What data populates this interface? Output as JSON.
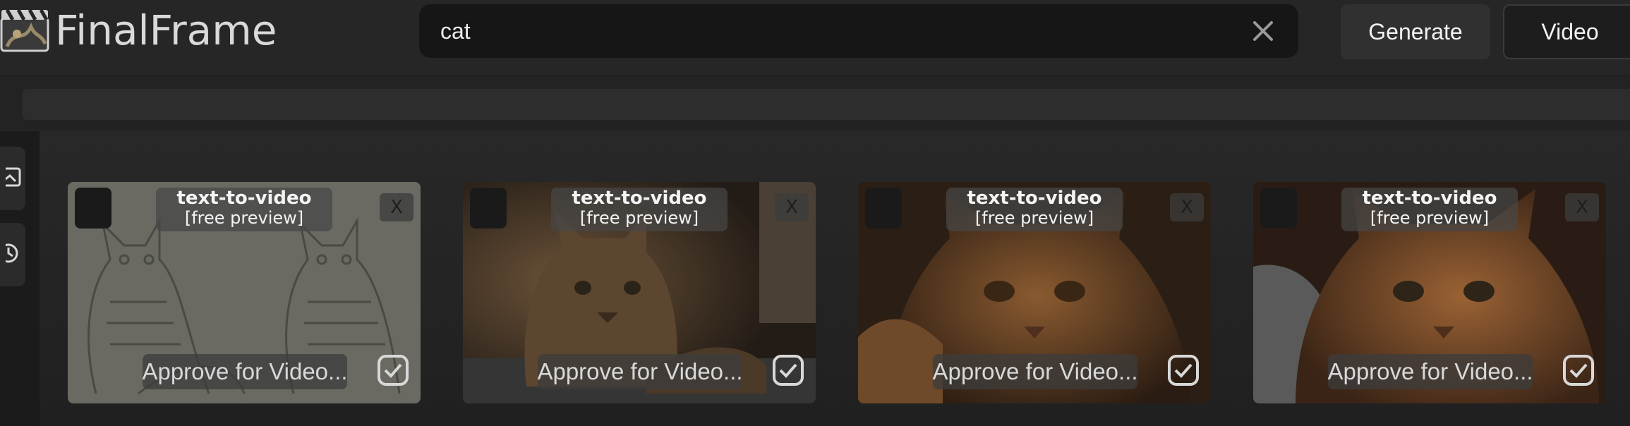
{
  "app": {
    "title": "FinalFrame",
    "logo_icon": "clapperboard-icon"
  },
  "search": {
    "value": "cat",
    "clear_icon": "close-icon"
  },
  "toolbar": {
    "generate_label": "Generate",
    "video_label": "Video"
  },
  "progress": {
    "fraction": 0.0
  },
  "sidebar": {
    "items": [
      {
        "icon": "images-icon"
      },
      {
        "icon": "circle-icon"
      }
    ]
  },
  "cards": [
    {
      "title": "text-to-video",
      "subtitle": "[free preview]",
      "close_label": "X",
      "approve_label": "Approve for Video...",
      "image": "sketch of two cats"
    },
    {
      "title": "text-to-video",
      "subtitle": "[free preview]",
      "close_label": "X",
      "approve_label": "Approve for Video...",
      "image": "tabby cat lying indoors"
    },
    {
      "title": "text-to-video",
      "subtitle": "[free preview]",
      "close_label": "X",
      "approve_label": "Approve for Video...",
      "image": "orange cat close-up"
    },
    {
      "title": "text-to-video",
      "subtitle": "[free preview]",
      "close_label": "X",
      "approve_label": "Approve for Video...",
      "image": "fluffy orange cat close-up"
    }
  ],
  "colors": {
    "background": "#232323",
    "surface": "#262626",
    "search_bg": "#161616",
    "accent_text": "#f2f2f2"
  }
}
